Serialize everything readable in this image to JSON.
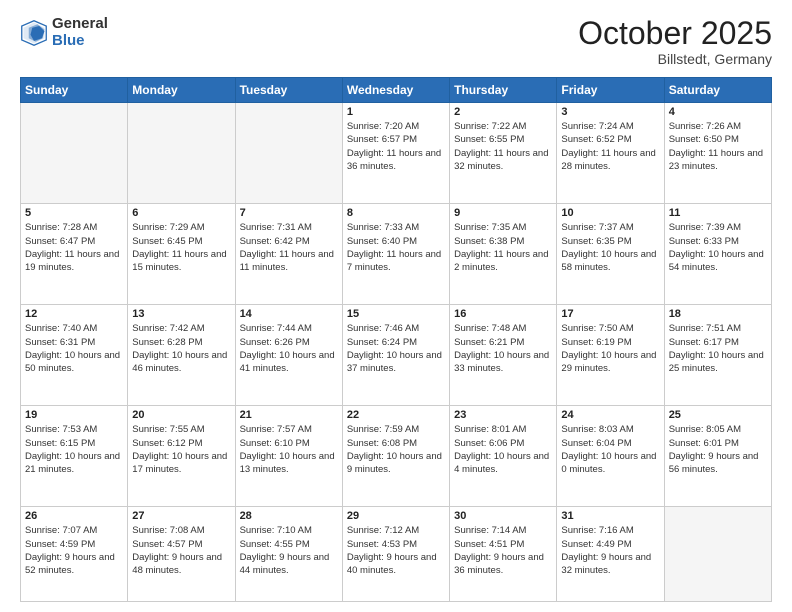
{
  "logo": {
    "general": "General",
    "blue": "Blue"
  },
  "header": {
    "month": "October 2025",
    "location": "Billstedt, Germany"
  },
  "days_of_week": [
    "Sunday",
    "Monday",
    "Tuesday",
    "Wednesday",
    "Thursday",
    "Friday",
    "Saturday"
  ],
  "weeks": [
    [
      {
        "num": "",
        "info": ""
      },
      {
        "num": "",
        "info": ""
      },
      {
        "num": "",
        "info": ""
      },
      {
        "num": "1",
        "info": "Sunrise: 7:20 AM\nSunset: 6:57 PM\nDaylight: 11 hours\nand 36 minutes."
      },
      {
        "num": "2",
        "info": "Sunrise: 7:22 AM\nSunset: 6:55 PM\nDaylight: 11 hours\nand 32 minutes."
      },
      {
        "num": "3",
        "info": "Sunrise: 7:24 AM\nSunset: 6:52 PM\nDaylight: 11 hours\nand 28 minutes."
      },
      {
        "num": "4",
        "info": "Sunrise: 7:26 AM\nSunset: 6:50 PM\nDaylight: 11 hours\nand 23 minutes."
      }
    ],
    [
      {
        "num": "5",
        "info": "Sunrise: 7:28 AM\nSunset: 6:47 PM\nDaylight: 11 hours\nand 19 minutes."
      },
      {
        "num": "6",
        "info": "Sunrise: 7:29 AM\nSunset: 6:45 PM\nDaylight: 11 hours\nand 15 minutes."
      },
      {
        "num": "7",
        "info": "Sunrise: 7:31 AM\nSunset: 6:42 PM\nDaylight: 11 hours\nand 11 minutes."
      },
      {
        "num": "8",
        "info": "Sunrise: 7:33 AM\nSunset: 6:40 PM\nDaylight: 11 hours\nand 7 minutes."
      },
      {
        "num": "9",
        "info": "Sunrise: 7:35 AM\nSunset: 6:38 PM\nDaylight: 11 hours\nand 2 minutes."
      },
      {
        "num": "10",
        "info": "Sunrise: 7:37 AM\nSunset: 6:35 PM\nDaylight: 10 hours\nand 58 minutes."
      },
      {
        "num": "11",
        "info": "Sunrise: 7:39 AM\nSunset: 6:33 PM\nDaylight: 10 hours\nand 54 minutes."
      }
    ],
    [
      {
        "num": "12",
        "info": "Sunrise: 7:40 AM\nSunset: 6:31 PM\nDaylight: 10 hours\nand 50 minutes."
      },
      {
        "num": "13",
        "info": "Sunrise: 7:42 AM\nSunset: 6:28 PM\nDaylight: 10 hours\nand 46 minutes."
      },
      {
        "num": "14",
        "info": "Sunrise: 7:44 AM\nSunset: 6:26 PM\nDaylight: 10 hours\nand 41 minutes."
      },
      {
        "num": "15",
        "info": "Sunrise: 7:46 AM\nSunset: 6:24 PM\nDaylight: 10 hours\nand 37 minutes."
      },
      {
        "num": "16",
        "info": "Sunrise: 7:48 AM\nSunset: 6:21 PM\nDaylight: 10 hours\nand 33 minutes."
      },
      {
        "num": "17",
        "info": "Sunrise: 7:50 AM\nSunset: 6:19 PM\nDaylight: 10 hours\nand 29 minutes."
      },
      {
        "num": "18",
        "info": "Sunrise: 7:51 AM\nSunset: 6:17 PM\nDaylight: 10 hours\nand 25 minutes."
      }
    ],
    [
      {
        "num": "19",
        "info": "Sunrise: 7:53 AM\nSunset: 6:15 PM\nDaylight: 10 hours\nand 21 minutes."
      },
      {
        "num": "20",
        "info": "Sunrise: 7:55 AM\nSunset: 6:12 PM\nDaylight: 10 hours\nand 17 minutes."
      },
      {
        "num": "21",
        "info": "Sunrise: 7:57 AM\nSunset: 6:10 PM\nDaylight: 10 hours\nand 13 minutes."
      },
      {
        "num": "22",
        "info": "Sunrise: 7:59 AM\nSunset: 6:08 PM\nDaylight: 10 hours\nand 9 minutes."
      },
      {
        "num": "23",
        "info": "Sunrise: 8:01 AM\nSunset: 6:06 PM\nDaylight: 10 hours\nand 4 minutes."
      },
      {
        "num": "24",
        "info": "Sunrise: 8:03 AM\nSunset: 6:04 PM\nDaylight: 10 hours\nand 0 minutes."
      },
      {
        "num": "25",
        "info": "Sunrise: 8:05 AM\nSunset: 6:01 PM\nDaylight: 9 hours\nand 56 minutes."
      }
    ],
    [
      {
        "num": "26",
        "info": "Sunrise: 7:07 AM\nSunset: 4:59 PM\nDaylight: 9 hours\nand 52 minutes."
      },
      {
        "num": "27",
        "info": "Sunrise: 7:08 AM\nSunset: 4:57 PM\nDaylight: 9 hours\nand 48 minutes."
      },
      {
        "num": "28",
        "info": "Sunrise: 7:10 AM\nSunset: 4:55 PM\nDaylight: 9 hours\nand 44 minutes."
      },
      {
        "num": "29",
        "info": "Sunrise: 7:12 AM\nSunset: 4:53 PM\nDaylight: 9 hours\nand 40 minutes."
      },
      {
        "num": "30",
        "info": "Sunrise: 7:14 AM\nSunset: 4:51 PM\nDaylight: 9 hours\nand 36 minutes."
      },
      {
        "num": "31",
        "info": "Sunrise: 7:16 AM\nSunset: 4:49 PM\nDaylight: 9 hours\nand 32 minutes."
      },
      {
        "num": "",
        "info": ""
      }
    ]
  ]
}
